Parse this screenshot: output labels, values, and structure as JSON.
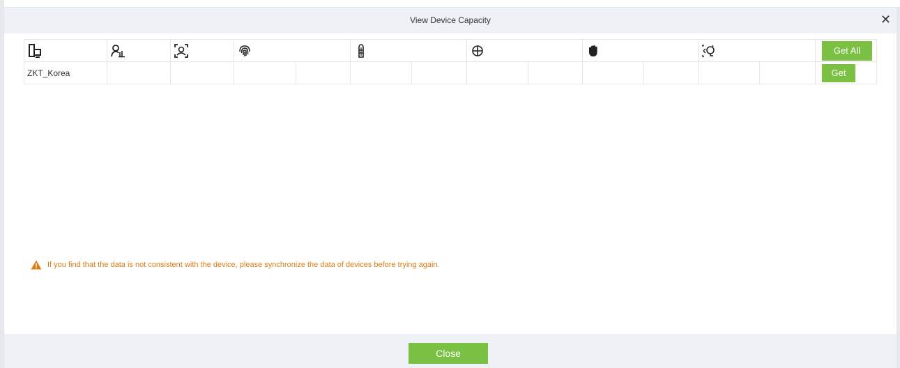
{
  "dialog": {
    "title": "View Device Capacity",
    "close_icon": "close-icon"
  },
  "table": {
    "header_icons": [
      "device-icon",
      "user-icon",
      "face-icon",
      "fingerprint-icon",
      "finger-vein-icon",
      "iris-icon",
      "palm-icon",
      "visible-light-face-icon"
    ],
    "get_all_label": "Get All",
    "rows": [
      {
        "device_name": "ZKT_Korea",
        "get_label": "Get"
      }
    ]
  },
  "warning": {
    "icon": "warning-icon",
    "text": "If you find that the data is not consistent with the device, please synchronize the data of devices before trying again."
  },
  "footer": {
    "close_label": "Close"
  },
  "colors": {
    "button_green": "#7ac143",
    "warning_orange": "#e07b10",
    "bar_gray": "#eef1f5"
  }
}
